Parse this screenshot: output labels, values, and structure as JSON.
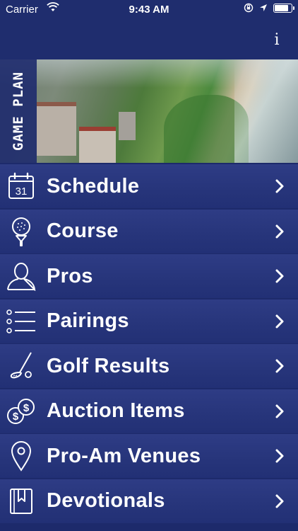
{
  "status_bar": {
    "carrier": "Carrier",
    "time": "9:43 AM",
    "battery_level": 0.9
  },
  "nav": {
    "info_label": "i"
  },
  "hero": {
    "badge": "GAME PLAN"
  },
  "menu": {
    "items": [
      {
        "label": "Schedule",
        "icon": "calendar-icon"
      },
      {
        "label": "Course",
        "icon": "golf-ball-tee-icon"
      },
      {
        "label": "Pros",
        "icon": "person-icon"
      },
      {
        "label": "Pairings",
        "icon": "list-icon"
      },
      {
        "label": "Golf Results",
        "icon": "golf-club-icon"
      },
      {
        "label": "Auction Items",
        "icon": "coins-icon"
      },
      {
        "label": "Pro-Am Venues",
        "icon": "location-pin-icon"
      },
      {
        "label": "Devotionals",
        "icon": "bookmark-book-icon"
      }
    ],
    "calendar_day": "31"
  }
}
